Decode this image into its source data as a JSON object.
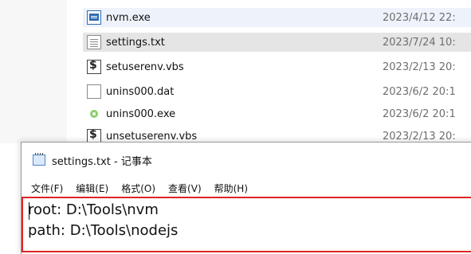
{
  "explorer": {
    "files": [
      {
        "name": "nvm.exe",
        "date": "2023/4/12 22:",
        "icon": "exe-app-icon"
      },
      {
        "name": "settings.txt",
        "date": "2023/7/24 10:",
        "icon": "text-file-icon"
      },
      {
        "name": "setuserenv.vbs",
        "date": "2023/2/13 20:",
        "icon": "vbs-script-icon"
      },
      {
        "name": "unins000.dat",
        "date": "2023/6/2 20:1",
        "icon": "dat-file-icon"
      },
      {
        "name": "unins000.exe",
        "date": "2023/6/2 20:1",
        "icon": "uninstaller-icon"
      },
      {
        "name": "unsetuserenv.vbs",
        "date": "2023/2/13 20:",
        "icon": "vbs-script-icon"
      }
    ]
  },
  "notepad": {
    "title": "settings.txt - 记事本",
    "menu": [
      "文件(F)",
      "编辑(E)",
      "格式(O)",
      "查看(V)",
      "帮助(H)"
    ],
    "content_lines": [
      "root: D:\\Tools\\nvm",
      "path: D:\\Tools\\nodejs"
    ],
    "highlight_color": "#e02424"
  }
}
